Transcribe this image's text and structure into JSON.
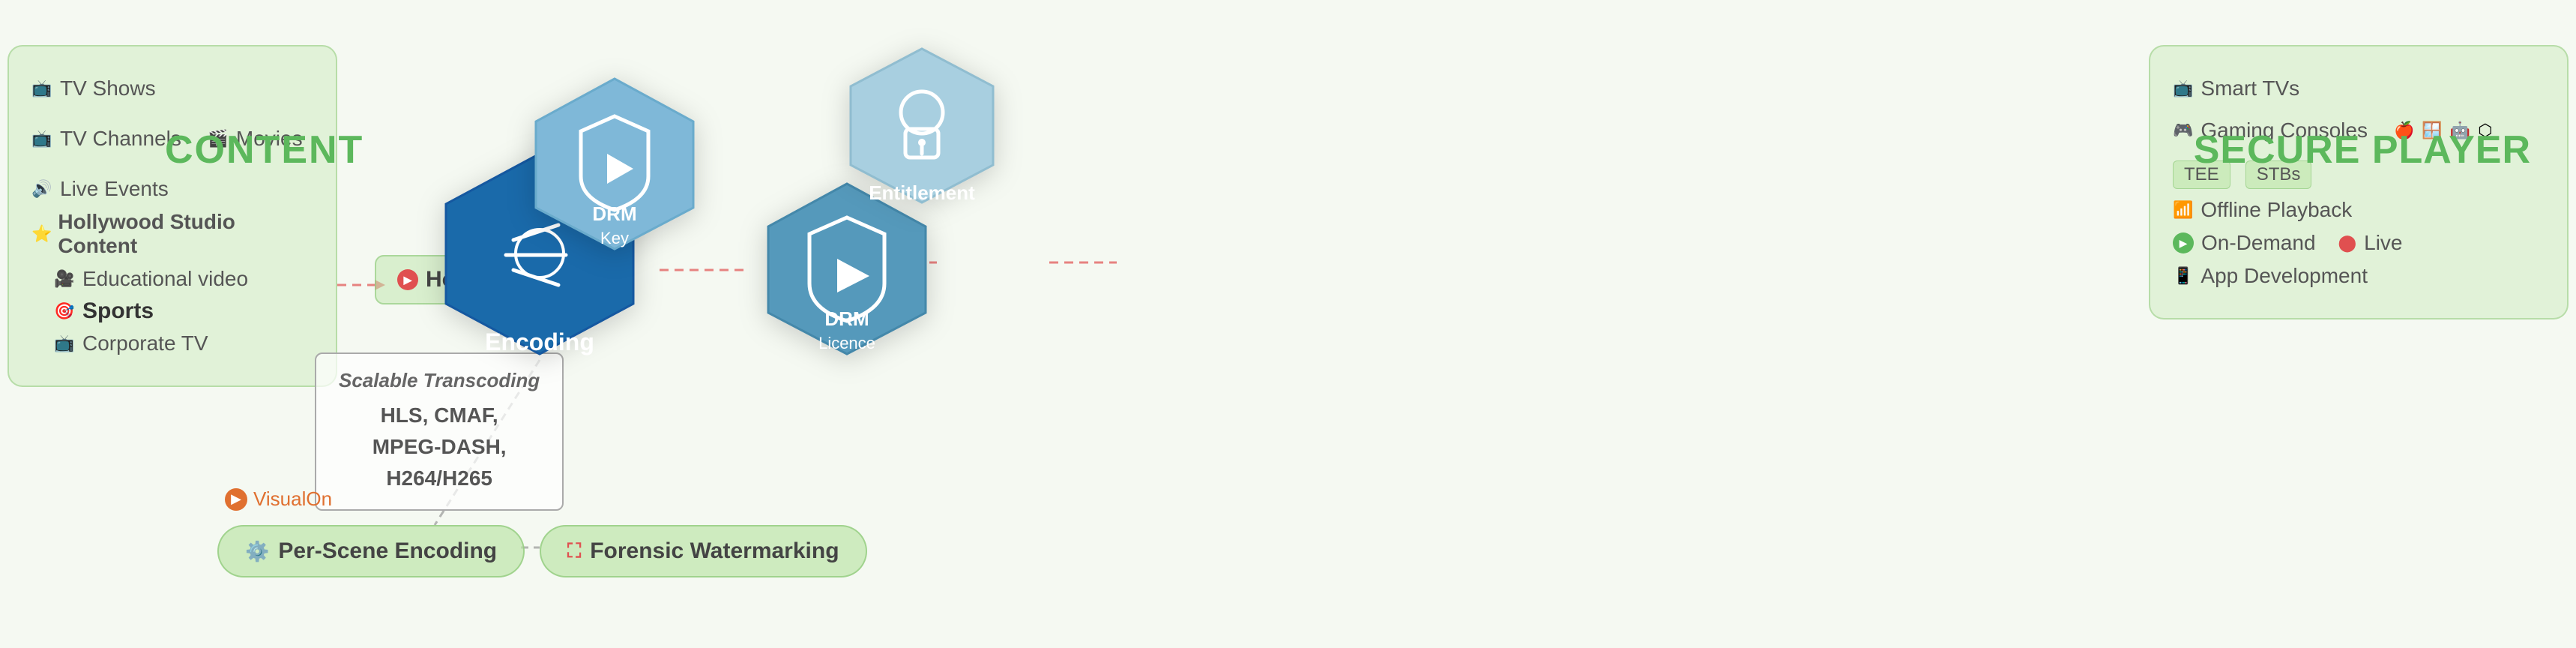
{
  "content": {
    "title": "CONTENT",
    "top_items": [
      {
        "icon": "📺",
        "label": "TV Shows"
      },
      {
        "icon": "📺",
        "label": "TV Channels"
      },
      {
        "icon": "🎬",
        "label": "Movies"
      },
      {
        "icon": "🔊",
        "label": "Live Events"
      }
    ],
    "hollywood": {
      "icon": "⭐",
      "label": "Hollywood Studio Content"
    },
    "sub_items": [
      {
        "icon": "📽️",
        "label": "Educational video"
      },
      {
        "icon": "🎯",
        "label": "Sports"
      },
      {
        "icon": "📺",
        "label": "Corporate TV"
      }
    ]
  },
  "hot_folder": {
    "icon": "🔴",
    "label": "Hot Folder"
  },
  "encoding": {
    "hex_label": "Encoding",
    "transcoding_title": "Scalable Transcoding",
    "formats": "HLS, CMAF,\nMPEG-DASH,\nH264/H265"
  },
  "drm_key": {
    "label": "DRM",
    "sublabel": "Key"
  },
  "drm_licence": {
    "label": "DRM",
    "sublabel": "Licence"
  },
  "entitlement": {
    "label": "Entitlement"
  },
  "per_scene": {
    "visualon": "VisualOn",
    "label": "Per-Scene Encoding"
  },
  "forensic": {
    "label": "Forensic Watermarking"
  },
  "secure_player": {
    "title": "SECURE PLAYER",
    "smart_tvs": "Smart TVs",
    "gaming_consoles": "Gaming Consoles",
    "tee": "TEE",
    "stbs": "STBs",
    "offline_playback": "Offline Playback",
    "on_demand": "On-Demand",
    "live": "Live",
    "app_development": "App Development"
  },
  "colors": {
    "green": "#5cb85c",
    "blue_dark": "#1a6aaa",
    "blue_light": "#6aabcc",
    "blue_pale": "#a8cfe0",
    "red": "#e05050",
    "orange": "#e07030",
    "yellow": "#e8c840"
  }
}
